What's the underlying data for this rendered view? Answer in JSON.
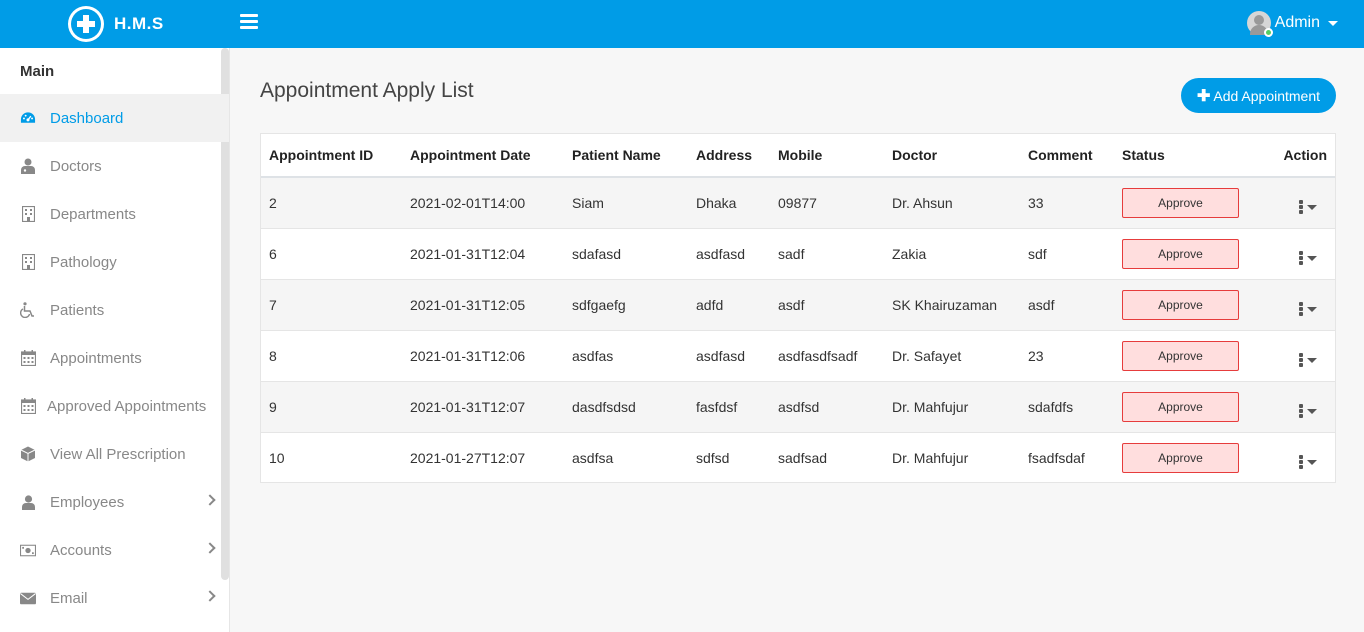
{
  "header": {
    "app_name": "H.M.S",
    "user_name": "Admin",
    "brand_color": "#009ce7",
    "online_color": "#55ce63"
  },
  "sidebar": {
    "section_title": "Main",
    "items": [
      {
        "label": "Dashboard",
        "icon": "dashboard-icon",
        "active": true,
        "has_submenu": false
      },
      {
        "label": "Doctors",
        "icon": "user-md-icon",
        "active": false,
        "has_submenu": false
      },
      {
        "label": "Departments",
        "icon": "building-icon",
        "active": false,
        "has_submenu": false
      },
      {
        "label": "Pathology",
        "icon": "building-icon",
        "active": false,
        "has_submenu": false
      },
      {
        "label": "Patients",
        "icon": "wheelchair-icon",
        "active": false,
        "has_submenu": false
      },
      {
        "label": "Appointments",
        "icon": "calendar-icon",
        "active": false,
        "has_submenu": false
      },
      {
        "label": "Approved Appointments",
        "icon": "calendar-icon",
        "active": false,
        "has_submenu": false
      },
      {
        "label": "View All Prescription",
        "icon": "cube-icon",
        "active": false,
        "has_submenu": false
      },
      {
        "label": "Employees",
        "icon": "user-icon",
        "active": false,
        "has_submenu": true
      },
      {
        "label": "Accounts",
        "icon": "money-icon",
        "active": false,
        "has_submenu": true
      },
      {
        "label": "Email",
        "icon": "envelope-icon",
        "active": false,
        "has_submenu": true
      }
    ]
  },
  "main": {
    "title": "Appointment Apply List",
    "add_button_label": "Add Appointment",
    "table": {
      "columns": [
        "Appointment ID",
        "Appointment Date",
        "Patient Name",
        "Address",
        "Mobile",
        "Doctor",
        "Comment",
        "Status",
        "Action"
      ],
      "rows": [
        {
          "id": "2",
          "date": "2021-02-01T14:00",
          "patient": "Siam",
          "address": "Dhaka",
          "mobile": "09877",
          "doctor": "Dr. Ahsun",
          "comment": "33",
          "status": "Approve"
        },
        {
          "id": "6",
          "date": "2021-01-31T12:04",
          "patient": "sdafasd",
          "address": "asdfasd",
          "mobile": "sadf",
          "doctor": "Zakia",
          "comment": "sdf",
          "status": "Approve"
        },
        {
          "id": "7",
          "date": "2021-01-31T12:05",
          "patient": "sdfgaefg",
          "address": "adfd",
          "mobile": "asdf",
          "doctor": "SK Khairuzaman",
          "comment": "asdf",
          "status": "Approve"
        },
        {
          "id": "8",
          "date": "2021-01-31T12:06",
          "patient": "asdfas",
          "address": "asdfasd",
          "mobile": "asdfasdfsadf",
          "doctor": "Dr. Safayet",
          "comment": "23",
          "status": "Approve"
        },
        {
          "id": "9",
          "date": "2021-01-31T12:07",
          "patient": "dasdfsdsd",
          "address": "fasfdsf",
          "mobile": "asdfsd",
          "doctor": "Dr. Mahfujur",
          "comment": "sdafdfs",
          "status": "Approve"
        },
        {
          "id": "10",
          "date": "2021-01-27T12:07",
          "patient": "asdfsa",
          "address": "sdfsd",
          "mobile": "sadfsad",
          "doctor": "Dr. Mahfujur",
          "comment": "fsadfsdaf",
          "status": "Approve"
        }
      ]
    }
  }
}
